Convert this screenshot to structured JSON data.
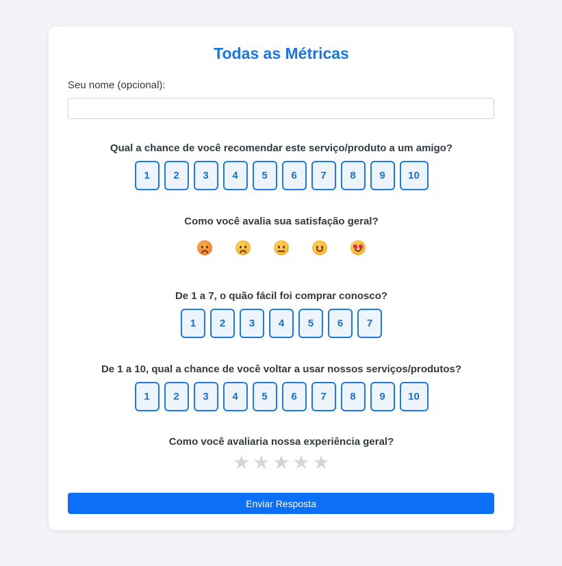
{
  "form": {
    "title": "Todas as Métricas",
    "name_label": "Seu nome (opcional):",
    "name_placeholder": "",
    "submit_label": "Enviar Resposta"
  },
  "questions": {
    "nps": {
      "text": "Qual a chance de você recomendar este serviço/produto a um amigo?",
      "options": [
        "1",
        "2",
        "3",
        "4",
        "5",
        "6",
        "7",
        "8",
        "9",
        "10"
      ]
    },
    "csat": {
      "text": "Como você avalia sua satisfação geral?",
      "options": [
        "angry-face",
        "confused-face",
        "neutral-face",
        "smiling-face",
        "heart-eyes-face"
      ]
    },
    "ces": {
      "text": "De 1 a 7, o quão fácil foi comprar conosco?",
      "options": [
        "1",
        "2",
        "3",
        "4",
        "5",
        "6",
        "7"
      ]
    },
    "retention": {
      "text": "De 1 a 10, qual a chance de você voltar a usar nossos serviços/produtos?",
      "options": [
        "1",
        "2",
        "3",
        "4",
        "5",
        "6",
        "7",
        "8",
        "9",
        "10"
      ]
    },
    "rating": {
      "text": "Como você avaliaria nossa experiência geral?",
      "max_stars": 5,
      "selected": 0
    }
  },
  "colors": {
    "accent": "#1976e8",
    "button_border": "#1a7be8",
    "button_bg": "#eef4fb",
    "submit_bg": "#0b6ff7",
    "star_empty": "#d3d6da",
    "page_bg": "#f3f4f8"
  }
}
